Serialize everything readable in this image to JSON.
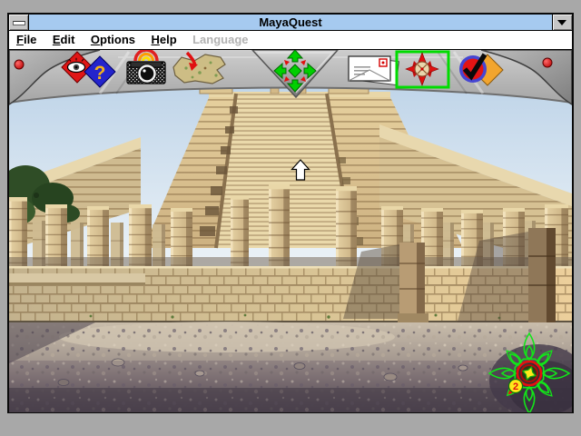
{
  "window": {
    "title": "MayaQuest",
    "controls": {
      "system_menu_icon": "dash-icon",
      "minimize_icon": "down-triangle-icon"
    }
  },
  "menu_bar": {
    "items": [
      {
        "label": "File",
        "accel": "F",
        "rest": "ile",
        "enabled": true
      },
      {
        "label": "Edit",
        "accel": "E",
        "rest": "dit",
        "enabled": true
      },
      {
        "label": "Options",
        "accel": "O",
        "rest": "ptions",
        "enabled": true
      },
      {
        "label": "Help",
        "accel": "H",
        "rest": "elp",
        "enabled": true
      },
      {
        "label": "Language",
        "accel": "",
        "rest": "Language",
        "enabled": false
      }
    ]
  },
  "toolbar": {
    "selected_tool": "compass-navigate",
    "icons": [
      {
        "name": "observe-question-icon",
        "glyph": "?"
      },
      {
        "name": "camera-icon"
      },
      {
        "name": "map-icon"
      },
      {
        "name": "move-arrows-icon"
      },
      {
        "name": "mail-envelope-icon"
      },
      {
        "name": "compass-navigate-icon",
        "selected": true
      },
      {
        "name": "confirm-check-icon"
      }
    ],
    "indicator_dots": 2
  },
  "viewport": {
    "cursor": "up-arrow-cursor",
    "scene": "mayan-temple-colonnade"
  },
  "compass_overlay": {
    "badge": "2",
    "direction_marker": "southwest"
  },
  "colors": {
    "desktop": "#a8a8a8",
    "title_bar": "#a6caf0",
    "title_text": "#000000",
    "menu_bg": "#ffffff",
    "disabled_text": "#b2b2b2",
    "toolbar_gray": "#b9b9b9",
    "selection_green": "#00dc00",
    "indicator_red": "#e00000",
    "overlay_green": "#12e619",
    "badge_yellow": "#ffe81a"
  }
}
